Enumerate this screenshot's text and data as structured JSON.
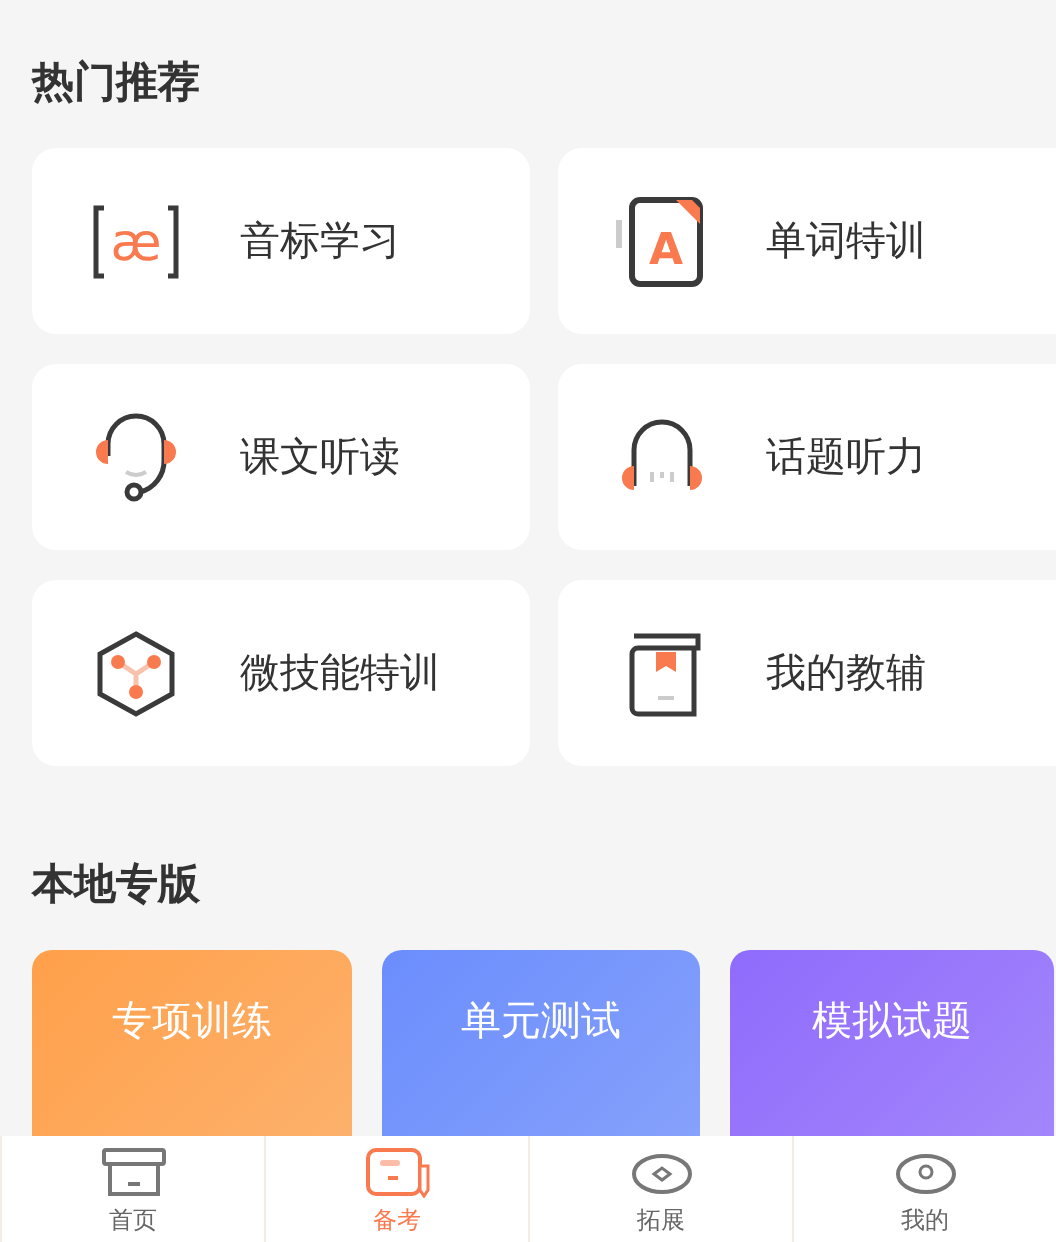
{
  "hot_section": {
    "title": "热门推荐"
  },
  "hot_items": [
    {
      "label": "音标学习",
      "icon_text": "æ"
    },
    {
      "label": "单词特训",
      "icon_text": "A"
    },
    {
      "label": "课文听读"
    },
    {
      "label": "话题听力"
    },
    {
      "label": "微技能特训"
    },
    {
      "label": "我的教辅"
    }
  ],
  "local_section": {
    "title": "本地专版"
  },
  "local_cards": [
    {
      "label": "专项训练",
      "color": "#ffa04a"
    },
    {
      "label": "单元测试",
      "color": "#6b8dfd"
    },
    {
      "label": "模拟试题",
      "color": "#8f6bfc"
    }
  ],
  "tab_bar": [
    {
      "label": "首页",
      "selected": false
    },
    {
      "label": "备考",
      "selected": true
    },
    {
      "label": "拓展",
      "selected": false
    },
    {
      "label": "我的",
      "selected": false
    }
  ]
}
